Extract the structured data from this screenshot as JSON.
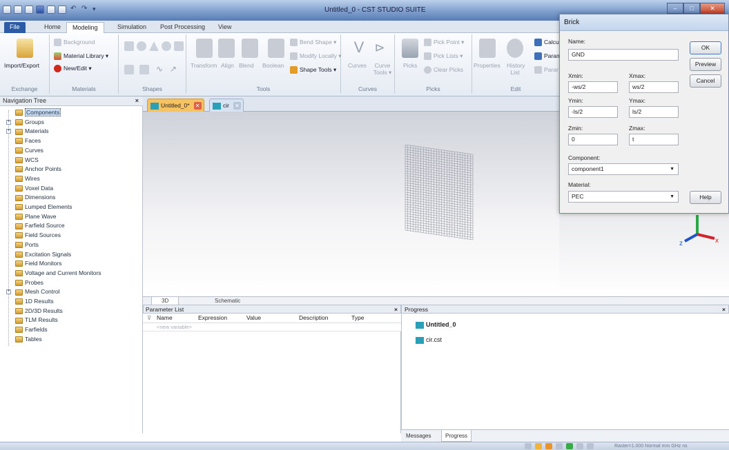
{
  "window": {
    "title": "Untitled_0 - CST STUDIO SUITE",
    "min": "–",
    "max": "□",
    "close": "✕"
  },
  "ribbon_tabs": [
    "File",
    "Home",
    "Modeling",
    "Simulation",
    "Post Processing",
    "View"
  ],
  "ribbon": {
    "exchange": {
      "group": "Exchange",
      "import_export": "Import/Export"
    },
    "materials": {
      "group": "Materials",
      "background": "Background",
      "material_library": "Material Library ▾",
      "new_edit": "New/Edit ▾"
    },
    "shapes": {
      "group": "Shapes"
    },
    "tools": {
      "group": "Tools",
      "transform": "Transform",
      "align": "Align",
      "blend": "Blend",
      "boolean": "Boolean",
      "bend_shape": "Bend Shape ▾",
      "modify_locally": "Modify Locally ▾",
      "shape_tools": "Shape Tools ▾"
    },
    "curves": {
      "group": "Curves",
      "curves": "Curves",
      "curve_tools": "Curve Tools ▾"
    },
    "picks": {
      "group": "Picks",
      "picks": "Picks",
      "pick_point": "Pick Point ▾",
      "pick_lists": "Pick Lists ▾",
      "clear_picks": "Clear Picks"
    },
    "edit": {
      "group": "Edit",
      "properties": "Properties",
      "history_list": "History List",
      "calc": "Calcu",
      "param1": "Param",
      "param2": "Parar"
    }
  },
  "navigation": {
    "title": "Navigation Tree",
    "close": "×",
    "items": [
      {
        "label": "Components",
        "exp": ""
      },
      {
        "label": "Groups",
        "exp": "+"
      },
      {
        "label": "Materials",
        "exp": "+"
      },
      {
        "label": "Faces",
        "exp": ""
      },
      {
        "label": "Curves",
        "exp": ""
      },
      {
        "label": "WCS",
        "exp": ""
      },
      {
        "label": "Anchor Points",
        "exp": ""
      },
      {
        "label": "Wires",
        "exp": ""
      },
      {
        "label": "Voxel Data",
        "exp": ""
      },
      {
        "label": "Dimensions",
        "exp": ""
      },
      {
        "label": "Lumped Elements",
        "exp": ""
      },
      {
        "label": "Plane Wave",
        "exp": ""
      },
      {
        "label": "Farfield Source",
        "exp": ""
      },
      {
        "label": "Field Sources",
        "exp": ""
      },
      {
        "label": "Ports",
        "exp": ""
      },
      {
        "label": "Excitation Signals",
        "exp": ""
      },
      {
        "label": "Field Monitors",
        "exp": ""
      },
      {
        "label": "Voltage and Current Monitors",
        "exp": ""
      },
      {
        "label": "Probes",
        "exp": ""
      },
      {
        "label": "Mesh Control",
        "exp": "+"
      },
      {
        "label": "1D Results",
        "exp": ""
      },
      {
        "label": "2D/3D Results",
        "exp": ""
      },
      {
        "label": "TLM Results",
        "exp": ""
      },
      {
        "label": "Farfields",
        "exp": ""
      },
      {
        "label": "Tables",
        "exp": ""
      }
    ]
  },
  "doc_tabs": [
    {
      "label": "Untitled_0*"
    },
    {
      "label": "cir"
    }
  ],
  "view_tabs": [
    "3D",
    "Schematic"
  ],
  "axes": {
    "y": "y",
    "x": "x",
    "z": "z"
  },
  "parameter_list": {
    "title": "Parameter List",
    "close": "×",
    "columns": [
      "Name",
      "Expression",
      "Value",
      "Description",
      "Type"
    ],
    "new_row_placeholder": "<new variable>",
    "filter_icon": "⊽"
  },
  "progress": {
    "title": "Progress",
    "close": "×",
    "items": [
      "Untitled_0",
      "cir.cst"
    ]
  },
  "bottom_tabs": [
    "Messages",
    "Progress"
  ],
  "status_bar": {
    "text": "Raster=1.000  Normal  mm  GHz  ns"
  },
  "brick": {
    "title": "Brick",
    "name_label": "Name:",
    "name": "GND",
    "xmin_label": "Xmin:",
    "xmin": "-ws/2",
    "xmax_label": "Xmax:",
    "xmax": "ws/2",
    "ymin_label": "Ymin:",
    "ymin": "-ls/2",
    "ymax_label": "Ymax:",
    "ymax": "ls/2",
    "zmin_label": "Zmin:",
    "zmin": "0",
    "zmax_label": "Zmax:",
    "zmax": "t",
    "component_label": "Component:",
    "component": "component1",
    "material_label": "Material:",
    "material": "PEC",
    "ok": "OK",
    "preview": "Preview",
    "cancel": "Cancel",
    "help": "Help"
  }
}
